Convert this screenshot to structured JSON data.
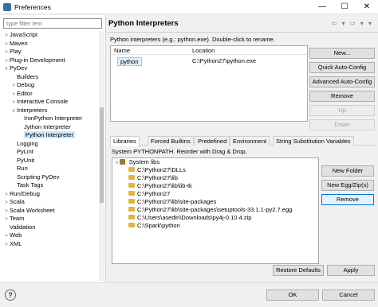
{
  "window": {
    "title": "Preferences",
    "minimize": "—",
    "maximize": "☐",
    "close": "✕"
  },
  "filter": {
    "placeholder": "type filter text"
  },
  "tree": [
    {
      "label": "JavaScript",
      "arrow": ">",
      "indent": 1
    },
    {
      "label": "Maven",
      "arrow": ">",
      "indent": 1
    },
    {
      "label": "Play",
      "arrow": ">",
      "indent": 1
    },
    {
      "label": "Plug-in Development",
      "arrow": ">",
      "indent": 1
    },
    {
      "label": "PyDev",
      "arrow": "v",
      "indent": 1
    },
    {
      "label": "Builders",
      "arrow": "",
      "indent": 2
    },
    {
      "label": "Debug",
      "arrow": ">",
      "indent": 2
    },
    {
      "label": "Editor",
      "arrow": ">",
      "indent": 2
    },
    {
      "label": "Interactive Console",
      "arrow": ">",
      "indent": 2
    },
    {
      "label": "Interpreters",
      "arrow": "v",
      "indent": 2
    },
    {
      "label": "IronPython Interpreter",
      "arrow": "",
      "indent": 3
    },
    {
      "label": "Jython Interpreter",
      "arrow": "",
      "indent": 3
    },
    {
      "label": "Python Interpreter",
      "arrow": "",
      "indent": 3,
      "selected": true
    },
    {
      "label": "Logging",
      "arrow": "",
      "indent": 2
    },
    {
      "label": "PyLint",
      "arrow": "",
      "indent": 2
    },
    {
      "label": "PyUnit",
      "arrow": "",
      "indent": 2
    },
    {
      "label": "Run",
      "arrow": "",
      "indent": 2
    },
    {
      "label": "Scripting PyDev",
      "arrow": "",
      "indent": 2
    },
    {
      "label": "Task Tags",
      "arrow": "",
      "indent": 2
    },
    {
      "label": "Run/Debug",
      "arrow": ">",
      "indent": 1
    },
    {
      "label": "Scala",
      "arrow": ">",
      "indent": 1
    },
    {
      "label": "Scala Worksheet",
      "arrow": ">",
      "indent": 1
    },
    {
      "label": "Team",
      "arrow": ">",
      "indent": 1
    },
    {
      "label": "Validation",
      "arrow": "",
      "indent": 1
    },
    {
      "label": "Web",
      "arrow": ">",
      "indent": 1
    },
    {
      "label": "XML",
      "arrow": ">",
      "indent": 1
    }
  ],
  "page": {
    "title": "Python Interpreters",
    "nav_icons": "⇦ ▾ ⇨ ▾ ▾",
    "description": "Python interpreters (e.g.: python.exe).  Double-click to rename."
  },
  "interp_table": {
    "headers": {
      "name": "Name",
      "location": "Location"
    },
    "row": {
      "name": "python",
      "location": "C:\\Python27\\python.exe"
    }
  },
  "interp_buttons": {
    "new": "New...",
    "quick": "Quick Auto-Config",
    "advanced": "Advanced Auto-Config",
    "remove": "Remove",
    "up": "Up",
    "down": "Down"
  },
  "tabs": [
    "Libraries",
    "Forced Builtins",
    "Predefined",
    "Environment",
    "String Substitution Variables"
  ],
  "syspath": {
    "label": "System PYTHONPATH.  Reorder with Drag & Drop.",
    "root": "System libs",
    "entries": [
      "C:\\Python27\\DLLs",
      "C:\\Python27\\lib",
      "C:\\Python27\\lib\\lib-tk",
      "C:\\Python27",
      "C:\\Python27\\lib\\site-packages",
      "C:\\Python27\\lib\\site-packages\\setuptools-33.1.1-py2.7.egg",
      "C:\\Users\\asedin\\Downloads\\py4j-0.10.4.zip",
      "C:\\Spark\\python"
    ]
  },
  "lib_buttons": {
    "new_folder": "New Folder",
    "new_egg": "New Egg/Zip(s)",
    "remove": "Remove"
  },
  "restore_defaults": "Restore Defaults",
  "apply": "Apply",
  "ok": "OK",
  "cancel": "Cancel",
  "help_icon": "?"
}
